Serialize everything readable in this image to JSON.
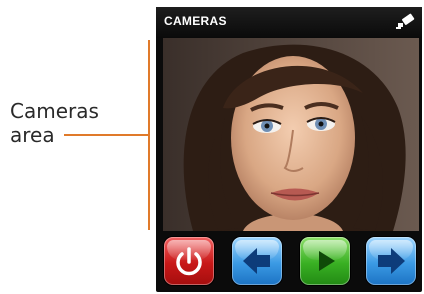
{
  "annotation": {
    "label": "Cameras\narea",
    "line_color": "#e07a2a"
  },
  "screen": {
    "title": "CAMERAS",
    "title_icon": "camera-icon",
    "video": {
      "description_icon": "camera-feed"
    },
    "controls": [
      {
        "name": "power-button",
        "icon": "power-icon",
        "color": "#d62020"
      },
      {
        "name": "previous-camera-button",
        "icon": "arrow-left-icon",
        "color": "#2b8ee0"
      },
      {
        "name": "play-button",
        "icon": "play-icon",
        "color": "#2fa81e"
      },
      {
        "name": "next-camera-button",
        "icon": "arrow-right-icon",
        "color": "#2b8ee0"
      }
    ]
  }
}
